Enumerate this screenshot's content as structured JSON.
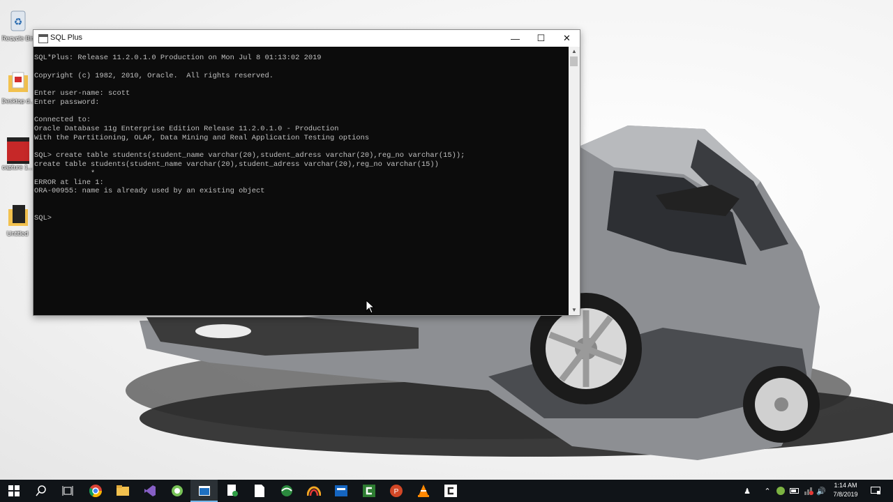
{
  "desktop": {
    "icons": [
      {
        "label": "Recycle Bin",
        "icon": "recycle-bin-icon"
      },
      {
        "label": "Desktop d...",
        "icon": "pdf-folder-icon"
      },
      {
        "label": "capture 1...",
        "icon": "video-file-icon"
      },
      {
        "label": "Untitled",
        "icon": "folder-icon"
      }
    ]
  },
  "window": {
    "title": "SQL Plus",
    "minimize_symbol": "—",
    "maximize_symbol": "☐",
    "close_symbol": "✕",
    "console_lines": [
      "SQL*Plus: Release 11.2.0.1.0 Production on Mon Jul 8 01:13:02 2019",
      "",
      "Copyright (c) 1982, 2010, Oracle.  All rights reserved.",
      "",
      "Enter user-name: scott",
      "Enter password:",
      "",
      "Connected to:",
      "Oracle Database 11g Enterprise Edition Release 11.2.0.1.0 - Production",
      "With the Partitioning, OLAP, Data Mining and Real Application Testing options",
      "",
      "SQL> create table students(student_name varchar(20),student_adress varchar(20),reg_no varchar(15));",
      "create table students(student_name varchar(20),student_adress varchar(20),reg_no varchar(15))",
      "             *",
      "ERROR at line 1:",
      "ORA-00955: name is already used by an existing object",
      "",
      "",
      "SQL>"
    ]
  },
  "taskbar": {
    "items": [
      {
        "name": "start-button",
        "icon": "windows-logo-icon"
      },
      {
        "name": "search-button",
        "icon": "search-icon"
      },
      {
        "name": "task-view-button",
        "icon": "task-view-icon"
      },
      {
        "name": "taskbar-chrome",
        "icon": "chrome-icon"
      },
      {
        "name": "taskbar-file-explorer",
        "icon": "folder-icon"
      },
      {
        "name": "taskbar-visual-studio",
        "icon": "visual-studio-icon"
      },
      {
        "name": "taskbar-android-studio",
        "icon": "android-studio-icon"
      },
      {
        "name": "taskbar-sqlplus",
        "icon": "console-window-icon",
        "active": true
      },
      {
        "name": "taskbar-file-app",
        "icon": "file-green-icon"
      },
      {
        "name": "taskbar-document",
        "icon": "blank-document-icon"
      },
      {
        "name": "taskbar-edge-app",
        "icon": "globe-icon"
      },
      {
        "name": "taskbar-app-arc",
        "icon": "arc-icon"
      },
      {
        "name": "taskbar-app-blue",
        "icon": "blue-app-icon"
      },
      {
        "name": "taskbar-camtasia",
        "icon": "camtasia-icon"
      },
      {
        "name": "taskbar-powerpoint",
        "icon": "powerpoint-icon"
      },
      {
        "name": "taskbar-vlc",
        "icon": "vlc-cone-icon"
      },
      {
        "name": "taskbar-app-c",
        "icon": "c-app-icon"
      }
    ],
    "tray": {
      "clock_time": "1:14 AM",
      "clock_date": "7/8/2019"
    }
  }
}
